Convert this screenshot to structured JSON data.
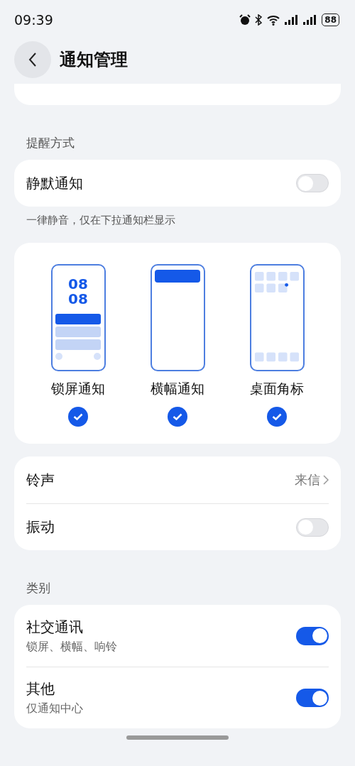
{
  "status_bar": {
    "time": "09:39",
    "battery": "88"
  },
  "header": {
    "title": "通知管理"
  },
  "sections": [
    {
      "label": "提醒方式",
      "rows": [
        {
          "kind": "toggle",
          "title": "静默通知",
          "on": false
        }
      ],
      "note": "一律静音，仅在下拉通知栏显示"
    },
    {
      "styles": [
        {
          "kind": "lockscreen",
          "label": "锁屏通知",
          "checked": true,
          "clock_lines": [
            "08",
            "08"
          ]
        },
        {
          "kind": "banner",
          "label": "横幅通知",
          "checked": true
        },
        {
          "kind": "badge",
          "label": "桌面角标",
          "checked": true
        }
      ]
    },
    {
      "rows": [
        {
          "kind": "link",
          "title": "铃声",
          "value": "来信"
        },
        {
          "kind": "toggle",
          "title": "振动",
          "on": false
        }
      ]
    },
    {
      "label": "类别",
      "rows": [
        {
          "kind": "toggle",
          "title": "社交通讯",
          "subtitle": "锁屏、横幅、响铃",
          "on": true
        },
        {
          "kind": "toggle",
          "title": "其他",
          "subtitle": "仅通知中心",
          "on": true
        }
      ]
    }
  ]
}
